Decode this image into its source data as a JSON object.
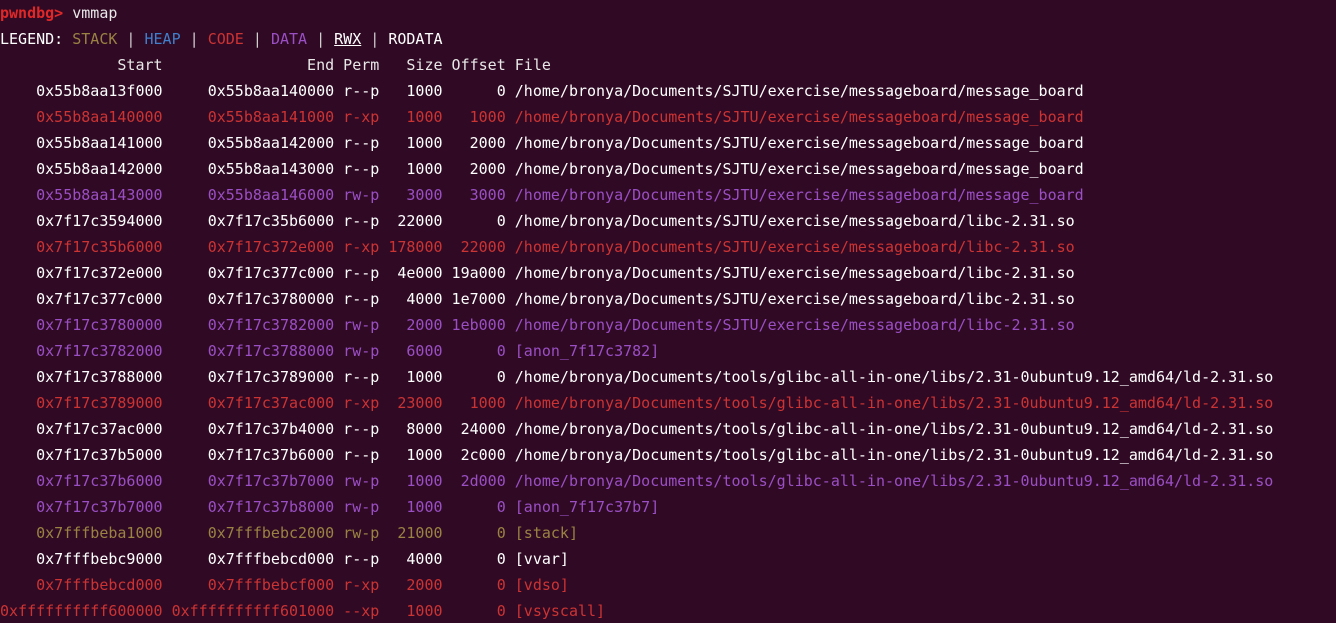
{
  "terminal": {
    "background_color": "#300a24",
    "prompt": "pwndbg>",
    "command": "vmmap"
  },
  "legend": {
    "label": "LEGEND:",
    "separator": "|",
    "items": [
      {
        "name": "STACK",
        "color": "#9a8243"
      },
      {
        "name": "HEAP",
        "color": "#3f7fcc"
      },
      {
        "name": "CODE",
        "color": "#cc3333"
      },
      {
        "name": "DATA",
        "color": "#9a4fc4"
      },
      {
        "name": "RWX",
        "color": "#ffffff"
      },
      {
        "name": "RODATA",
        "color": "#ffffff"
      }
    ]
  },
  "table": {
    "headers": {
      "start": "Start",
      "end": "End",
      "perm": "Perm",
      "size": "Size",
      "offset": "Offset",
      "file": "File"
    },
    "rows": [
      {
        "start": "0x55b8aa13f000",
        "end": "0x55b8aa140000",
        "perm": "r--p",
        "size": "1000",
        "offset": "0",
        "file": "/home/bronya/Documents/SJTU/exercise/messageboard/message_board",
        "color": "white"
      },
      {
        "start": "0x55b8aa140000",
        "end": "0x55b8aa141000",
        "perm": "r-xp",
        "size": "1000",
        "offset": "1000",
        "file": "/home/bronya/Documents/SJTU/exercise/messageboard/message_board",
        "color": "red"
      },
      {
        "start": "0x55b8aa141000",
        "end": "0x55b8aa142000",
        "perm": "r--p",
        "size": "1000",
        "offset": "2000",
        "file": "/home/bronya/Documents/SJTU/exercise/messageboard/message_board",
        "color": "white"
      },
      {
        "start": "0x55b8aa142000",
        "end": "0x55b8aa143000",
        "perm": "r--p",
        "size": "1000",
        "offset": "2000",
        "file": "/home/bronya/Documents/SJTU/exercise/messageboard/message_board",
        "color": "white"
      },
      {
        "start": "0x55b8aa143000",
        "end": "0x55b8aa146000",
        "perm": "rw-p",
        "size": "3000",
        "offset": "3000",
        "file": "/home/bronya/Documents/SJTU/exercise/messageboard/message_board",
        "color": "purple"
      },
      {
        "start": "0x7f17c3594000",
        "end": "0x7f17c35b6000",
        "perm": "r--p",
        "size": "22000",
        "offset": "0",
        "file": "/home/bronya/Documents/SJTU/exercise/messageboard/libc-2.31.so",
        "color": "white"
      },
      {
        "start": "0x7f17c35b6000",
        "end": "0x7f17c372e000",
        "perm": "r-xp",
        "size": "178000",
        "offset": "22000",
        "file": "/home/bronya/Documents/SJTU/exercise/messageboard/libc-2.31.so",
        "color": "red"
      },
      {
        "start": "0x7f17c372e000",
        "end": "0x7f17c377c000",
        "perm": "r--p",
        "size": "4e000",
        "offset": "19a000",
        "file": "/home/bronya/Documents/SJTU/exercise/messageboard/libc-2.31.so",
        "color": "white"
      },
      {
        "start": "0x7f17c377c000",
        "end": "0x7f17c3780000",
        "perm": "r--p",
        "size": "4000",
        "offset": "1e7000",
        "file": "/home/bronya/Documents/SJTU/exercise/messageboard/libc-2.31.so",
        "color": "white"
      },
      {
        "start": "0x7f17c3780000",
        "end": "0x7f17c3782000",
        "perm": "rw-p",
        "size": "2000",
        "offset": "1eb000",
        "file": "/home/bronya/Documents/SJTU/exercise/messageboard/libc-2.31.so",
        "color": "purple"
      },
      {
        "start": "0x7f17c3782000",
        "end": "0x7f17c3788000",
        "perm": "rw-p",
        "size": "6000",
        "offset": "0",
        "file": "[anon_7f17c3782]",
        "color": "purple"
      },
      {
        "start": "0x7f17c3788000",
        "end": "0x7f17c3789000",
        "perm": "r--p",
        "size": "1000",
        "offset": "0",
        "file": "/home/bronya/Documents/tools/glibc-all-in-one/libs/2.31-0ubuntu9.12_amd64/ld-2.31.so",
        "color": "white"
      },
      {
        "start": "0x7f17c3789000",
        "end": "0x7f17c37ac000",
        "perm": "r-xp",
        "size": "23000",
        "offset": "1000",
        "file": "/home/bronya/Documents/tools/glibc-all-in-one/libs/2.31-0ubuntu9.12_amd64/ld-2.31.so",
        "color": "red"
      },
      {
        "start": "0x7f17c37ac000",
        "end": "0x7f17c37b4000",
        "perm": "r--p",
        "size": "8000",
        "offset": "24000",
        "file": "/home/bronya/Documents/tools/glibc-all-in-one/libs/2.31-0ubuntu9.12_amd64/ld-2.31.so",
        "color": "white"
      },
      {
        "start": "0x7f17c37b5000",
        "end": "0x7f17c37b6000",
        "perm": "r--p",
        "size": "1000",
        "offset": "2c000",
        "file": "/home/bronya/Documents/tools/glibc-all-in-one/libs/2.31-0ubuntu9.12_amd64/ld-2.31.so",
        "color": "white"
      },
      {
        "start": "0x7f17c37b6000",
        "end": "0x7f17c37b7000",
        "perm": "rw-p",
        "size": "1000",
        "offset": "2d000",
        "file": "/home/bronya/Documents/tools/glibc-all-in-one/libs/2.31-0ubuntu9.12_amd64/ld-2.31.so",
        "color": "purple"
      },
      {
        "start": "0x7f17c37b7000",
        "end": "0x7f17c37b8000",
        "perm": "rw-p",
        "size": "1000",
        "offset": "0",
        "file": "[anon_7f17c37b7]",
        "color": "purple"
      },
      {
        "start": "0x7fffbeba1000",
        "end": "0x7fffbebc2000",
        "perm": "rw-p",
        "size": "21000",
        "offset": "0",
        "file": "[stack]",
        "color": "olive"
      },
      {
        "start": "0x7fffbebc9000",
        "end": "0x7fffbebcd000",
        "perm": "r--p",
        "size": "4000",
        "offset": "0",
        "file": "[vvar]",
        "color": "white"
      },
      {
        "start": "0x7fffbebcd000",
        "end": "0x7fffbebcf000",
        "perm": "r-xp",
        "size": "2000",
        "offset": "0",
        "file": "[vdso]",
        "color": "red"
      },
      {
        "start": "0xffffffffff600000",
        "end": "0xffffffffff601000",
        "perm": "--xp",
        "size": "1000",
        "offset": "0",
        "file": "[vsyscall]",
        "color": "red"
      }
    ]
  }
}
